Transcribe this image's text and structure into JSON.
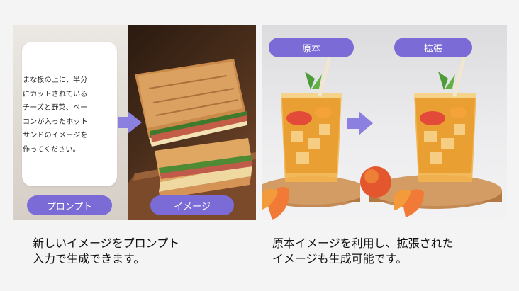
{
  "left": {
    "prompt_text": "まな板の上に、半分\nにカットされている\nチーズと野菜、ベー\nコンが入ったホット\nサンドのイメージを\n作ってください。",
    "prompt_label": "プロンプト",
    "image_label": "イメージ",
    "caption": "新しいイメージをプロンプト\n入力で生成できます。"
  },
  "right": {
    "original_label": "原本",
    "expanded_label": "拡張",
    "caption": "原本イメージを利用し、拡張された\nイメージも生成可能です。"
  },
  "colors": {
    "accent": "#7b6bd6",
    "arrow": "#8b7fe0"
  },
  "icons": [
    "arrow-right-icon"
  ]
}
